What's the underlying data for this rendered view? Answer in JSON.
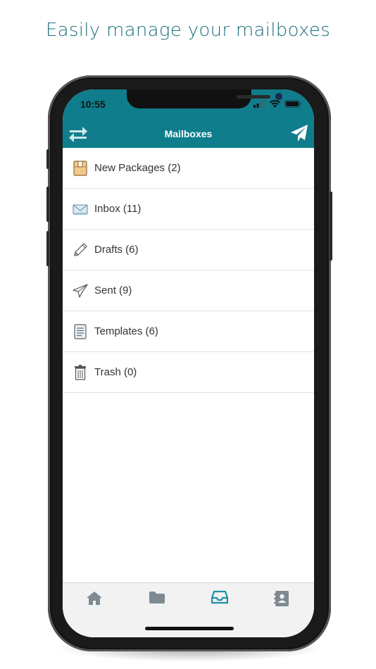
{
  "promo": {
    "title": "Easily manage your mailboxes"
  },
  "status_bar": {
    "time": "10:55"
  },
  "nav": {
    "title": "Mailboxes",
    "left_icon": "swap-arrows-icon",
    "right_icon": "paper-plane-icon"
  },
  "mailboxes": [
    {
      "label": "New Packages (2)",
      "icon": "package-icon"
    },
    {
      "label": "Inbox (11)",
      "icon": "inbox-envelope-icon"
    },
    {
      "label": "Drafts (6)",
      "icon": "pencil-icon"
    },
    {
      "label": "Sent (9)",
      "icon": "paper-plane-outline-icon"
    },
    {
      "label": "Templates (6)",
      "icon": "template-document-icon"
    },
    {
      "label": "Trash (0)",
      "icon": "trash-icon"
    }
  ],
  "tabbar": {
    "tabs": [
      {
        "icon": "home-icon",
        "active": false
      },
      {
        "icon": "folder-icon",
        "active": false
      },
      {
        "icon": "inbox-tray-icon",
        "active": true
      },
      {
        "icon": "contacts-icon",
        "active": false
      }
    ],
    "colors": {
      "active": "#1b8fa5",
      "inactive": "#7e8a92"
    }
  },
  "colors": {
    "header": "#0f7d8c",
    "promo_text": "#1d6f7c"
  }
}
